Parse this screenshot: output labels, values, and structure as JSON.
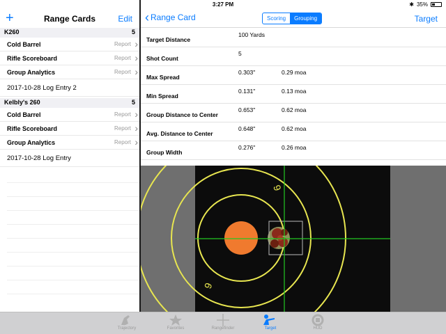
{
  "status": {
    "device": "iPad",
    "time": "3:27 PM",
    "battery": "35%"
  },
  "left": {
    "title": "Range Cards",
    "edit": "Edit",
    "sections": [
      {
        "name": "K260",
        "count": "5",
        "items": [
          {
            "label": "Cold Barrel",
            "action": "Report"
          },
          {
            "label": "Rifle Scoreboard",
            "action": "Report"
          },
          {
            "label": "Group Analytics",
            "action": "Report"
          }
        ],
        "log": "2017-10-28 Log Entry 2"
      },
      {
        "name": "Kelbly's 260",
        "count": "5",
        "items": [
          {
            "label": "Cold Barrel",
            "action": "Report"
          },
          {
            "label": "Rifle Scoreboard",
            "action": "Report"
          },
          {
            "label": "Group Analytics",
            "action": "Report"
          }
        ],
        "log": "2017-10-28 Log Entry"
      }
    ]
  },
  "right": {
    "back": "Range Card",
    "segments": [
      "Scoring",
      "Grouping"
    ],
    "selected_segment": "Grouping",
    "target_link": "Target",
    "stats": [
      {
        "label": "Target Distance",
        "v1": "100 Yards",
        "v2": ""
      },
      {
        "label": "Shot Count",
        "v1": "5",
        "v2": ""
      },
      {
        "label": "Max Spread",
        "v1": "0.303\"",
        "v2": "0.29 moa"
      },
      {
        "label": "Min Spread",
        "v1": "0.131\"",
        "v2": "0.13 moa"
      },
      {
        "label": "Group Distance to Center",
        "v1": "0.653\"",
        "v2": "0.62 moa"
      },
      {
        "label": "Avg. Distance to Center",
        "v1": "0.648\"",
        "v2": "0.62 moa"
      },
      {
        "label": "Group Width",
        "v1": "0.276\"",
        "v2": "0.26 moa"
      }
    ],
    "target_rings": [
      "9",
      "9"
    ]
  },
  "tabs": [
    {
      "label": "Trajectory",
      "icon": "rifle-icon",
      "active": false
    },
    {
      "label": "Favorites",
      "icon": "star-icon",
      "active": false
    },
    {
      "label": "Rangefinder",
      "icon": "crosshair-icon",
      "active": false
    },
    {
      "label": "Target",
      "icon": "shooter-icon",
      "active": true
    },
    {
      "label": "HUD",
      "icon": "hud-icon",
      "active": false
    }
  ],
  "colors": {
    "accent": "#0a7cff",
    "ring": "#e8e650",
    "bullseye": "#f07a2e",
    "crosshair": "#22c822"
  }
}
